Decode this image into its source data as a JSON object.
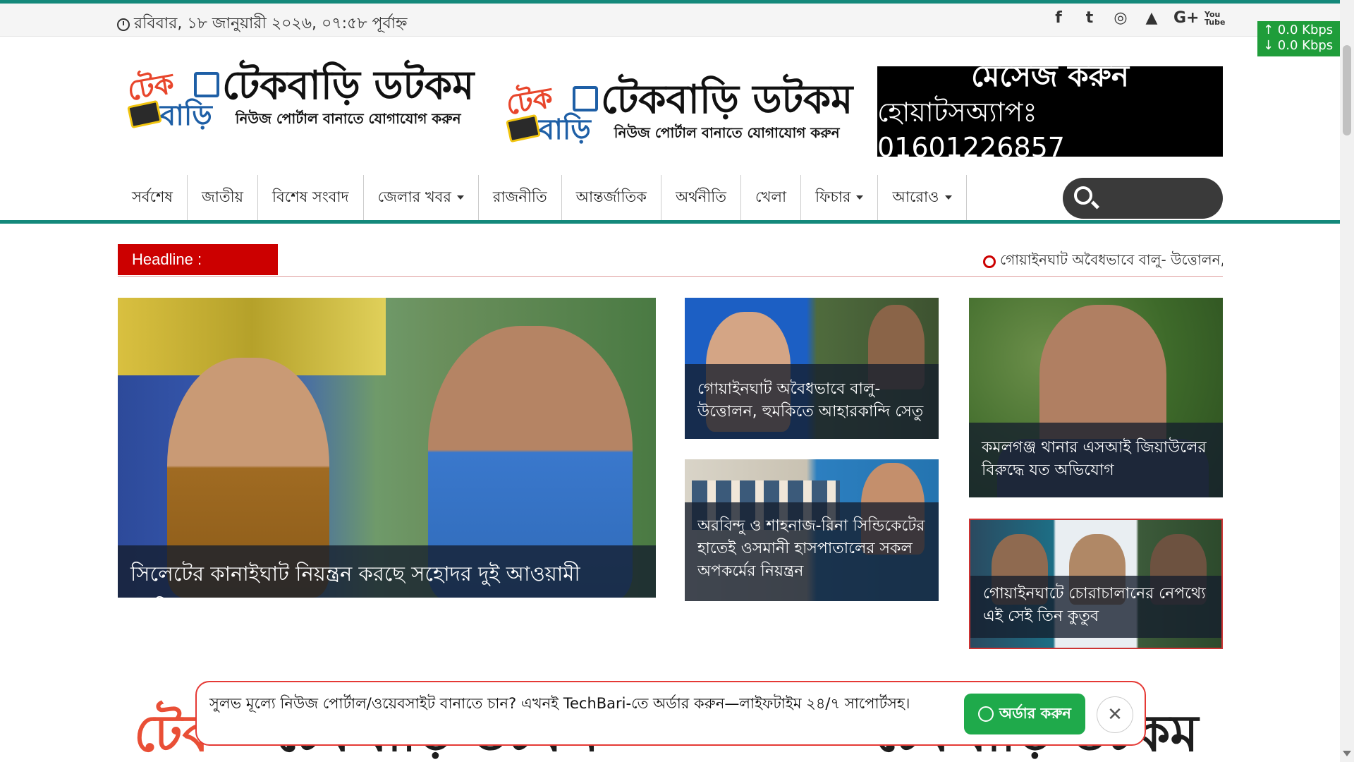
{
  "topbar": {
    "date": "রবিবার, ১৮ জানুয়ারী ২০২৬, ০৭:৫৮ পূর্বাহ্ন",
    "social": [
      "f",
      "t",
      "◎",
      "▲",
      "G+",
      "You Tube"
    ]
  },
  "netspeed": {
    "up": "↑ 0.0 Kbps",
    "down": "↓ 0.0 Kbps"
  },
  "logo": {
    "tek": "টেক",
    "bari": "বাড়ি",
    "title": "টেকবাড়ি ডটকম",
    "subtitle": "নিউজ পোর্টাল বানাতে যোগাযোগ করুন"
  },
  "header_ad": {
    "line1": "মেসেজ করুন",
    "line2": "হোয়াটসঅ্যাপঃ 01601226857"
  },
  "nav": {
    "items": [
      {
        "label": "সর্বশেষ"
      },
      {
        "label": "জাতীয়"
      },
      {
        "label": "বিশেষ সংবাদ"
      },
      {
        "label": "জেলার খবর"
      },
      {
        "label": "রাজনীতি"
      },
      {
        "label": "আন্তর্জাতিক"
      },
      {
        "label": "অর্থনীতি"
      },
      {
        "label": "খেলা"
      },
      {
        "label": "ফিচার"
      },
      {
        "label": "আরোও"
      }
    ]
  },
  "ticker": {
    "label": "Headline :",
    "item": "গোয়াইনঘাট অবৈধভাবে বালু- উত্তোলন, হুমকিতে আহারকান্দি সেতু"
  },
  "news": {
    "main": {
      "title": "সিলেটের কানাইঘাট নিয়ন্ত্রন করছে সহোদর দুই আওয়ামী ডেভিল"
    },
    "mid1": {
      "title": "গোয়াইনঘাট অবৈধভাবে বালু- উত্তোলন, হুমকিতে আহারকান্দি সেতু"
    },
    "mid2": {
      "title": "অরবিন্দু ও শাহনাজ-রিনা সিন্ডিকেটের হাতেই ওসমানী হাসপাতালের সকল অপকর্মের নিয়ন্ত্রন"
    },
    "right1": {
      "title": "কমলগঞ্জ থানার এসআই জিয়াউলের বিরুদ্ধে যত অভিযোগ"
    },
    "right2": {
      "title": "গোয়াইনঘাটে চোরাচালানের নেপথ্যে এই সেই তিন কুতুব"
    }
  },
  "popup": {
    "text": "সুলভ মূল্যে নিউজ পোর্টাল/ওয়েবসাইট বানাতে চান? এখনই TechBari-তে অর্ডার করুন—লাইফটাইম ২৪/৭ সাপোর্টসহ।",
    "button": "অর্ডার করুন",
    "close": "✕"
  }
}
